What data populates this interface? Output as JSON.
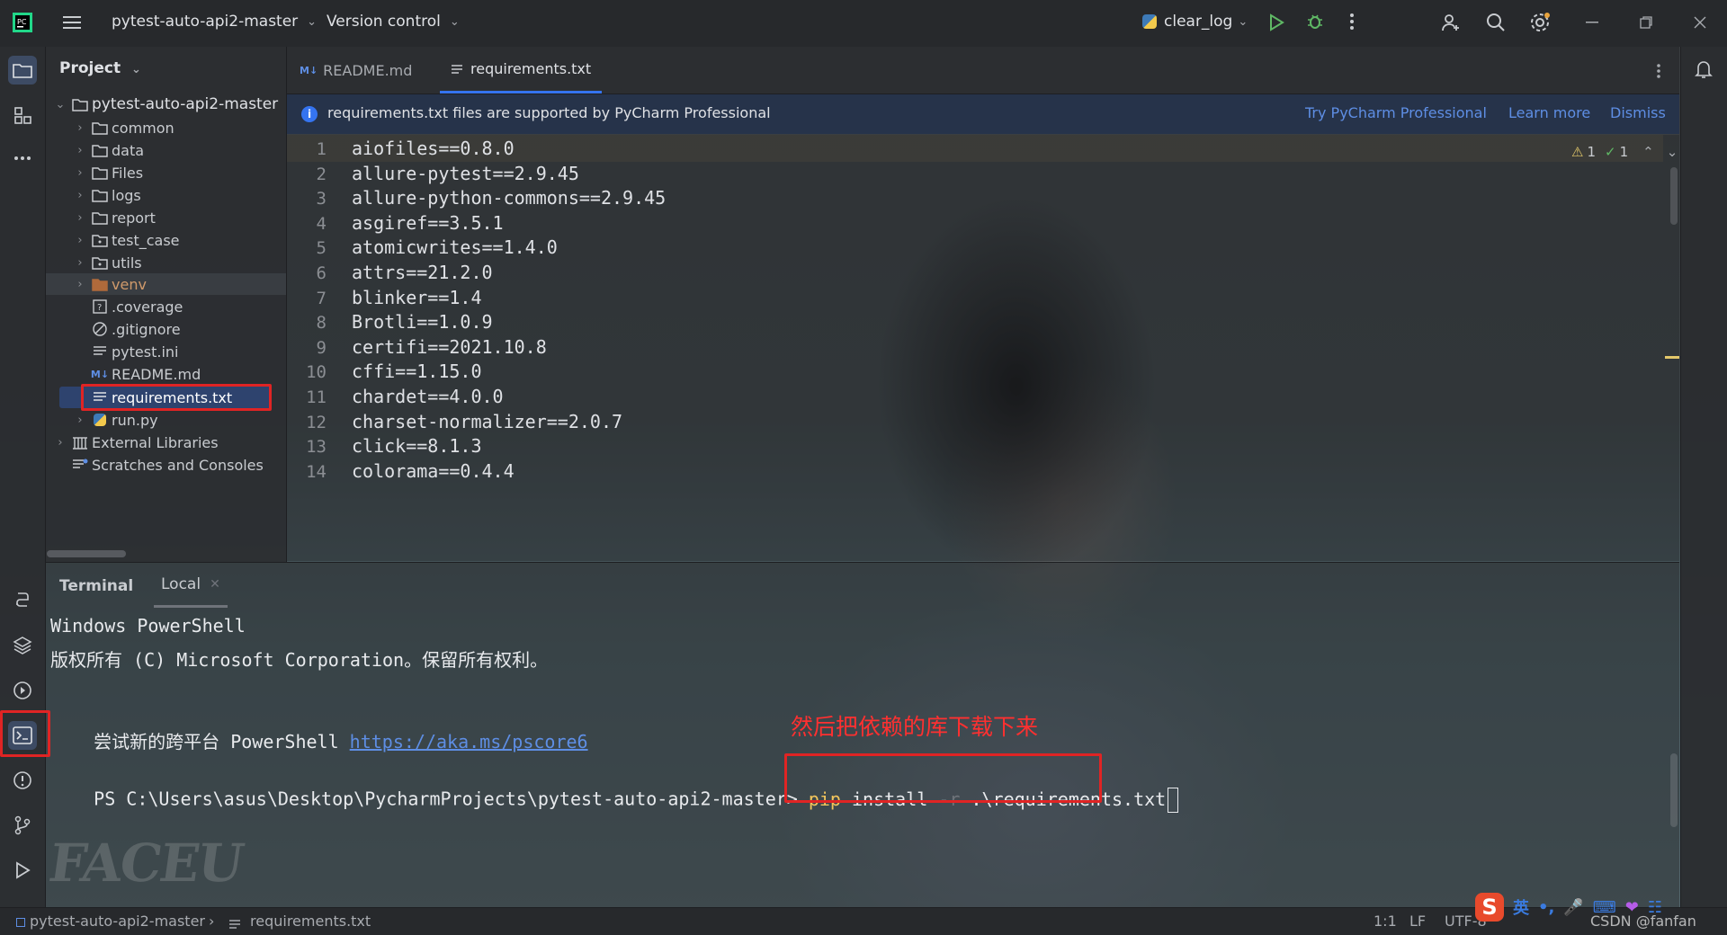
{
  "app": {
    "project_name": "pytest-auto-api2-master",
    "version_control": "Version control",
    "run_config": "clear_log"
  },
  "project_panel": {
    "title": "Project",
    "root": "pytest-auto-api2-master",
    "items": [
      {
        "label": "common",
        "type": "folder"
      },
      {
        "label": "data",
        "type": "folder"
      },
      {
        "label": "Files",
        "type": "folder"
      },
      {
        "label": "logs",
        "type": "folder"
      },
      {
        "label": "report",
        "type": "folder"
      },
      {
        "label": "test_case",
        "type": "folder"
      },
      {
        "label": "utils",
        "type": "folder"
      },
      {
        "label": "venv",
        "type": "folder"
      },
      {
        "label": ".coverage",
        "type": "file"
      },
      {
        "label": ".gitignore",
        "type": "file"
      },
      {
        "label": "pytest.ini",
        "type": "file"
      },
      {
        "label": "README.md",
        "type": "markdown"
      },
      {
        "label": "requirements.txt",
        "type": "text"
      },
      {
        "label": "run.py",
        "type": "python"
      }
    ],
    "external_libraries": "External Libraries",
    "scratches": "Scratches and Consoles"
  },
  "tabs": [
    {
      "label": "README.md",
      "active": false
    },
    {
      "label": "requirements.txt",
      "active": true
    }
  ],
  "banner": {
    "message": "requirements.txt files are supported by PyCharm Professional",
    "try_link": "Try PyCharm Professional",
    "learn_link": "Learn more",
    "dismiss_link": "Dismiss"
  },
  "inspection": {
    "warnings": "1",
    "ok": "1"
  },
  "editor_lines": [
    "aiofiles==0.8.0",
    "allure-pytest==2.9.45",
    "allure-python-commons==2.9.45",
    "asgiref==3.5.1",
    "atomicwrites==1.4.0",
    "attrs==21.2.0",
    "blinker==1.4",
    "Brotli==1.0.9",
    "certifi==2021.10.8",
    "cffi==1.15.0",
    "chardet==4.0.0",
    "charset-normalizer==2.0.7",
    "click==8.1.3",
    "colorama==0.4.4"
  ],
  "line_numbers": [
    "1",
    "2",
    "3",
    "4",
    "5",
    "6",
    "7",
    "8",
    "9",
    "10",
    "11",
    "12",
    "13",
    "14"
  ],
  "terminal": {
    "title": "Terminal",
    "tab_local": "Local",
    "line1": "Windows PowerShell",
    "line2": "版权所有 (C) Microsoft Corporation。保留所有权利。",
    "line3_text": "尝试新的跨平台 PowerShell ",
    "line3_link": "https://aka.ms/pscore6",
    "prompt": "PS C:\\Users\\asus\\Desktop\\PycharmProjects\\pytest-auto-api2-master>",
    "cmd_pip": "pip",
    "cmd_install": " install ",
    "cmd_flag": "-r",
    "cmd_arg": " .\\requirements.txt",
    "annotation": "然后把依赖的库下载下来"
  },
  "statusbar": {
    "breadcrumb_project": "pytest-auto-api2-master",
    "breadcrumb_file": "requirements.txt",
    "position": "1:1",
    "line_ending": "LF",
    "encoding": "UTF-8",
    "watermark": "CSDN @fanfan"
  },
  "ime": {
    "lang": "英"
  },
  "colors": {
    "accent": "#3574f0",
    "annotation_red": "#e02424",
    "link": "#5e8ee4"
  }
}
